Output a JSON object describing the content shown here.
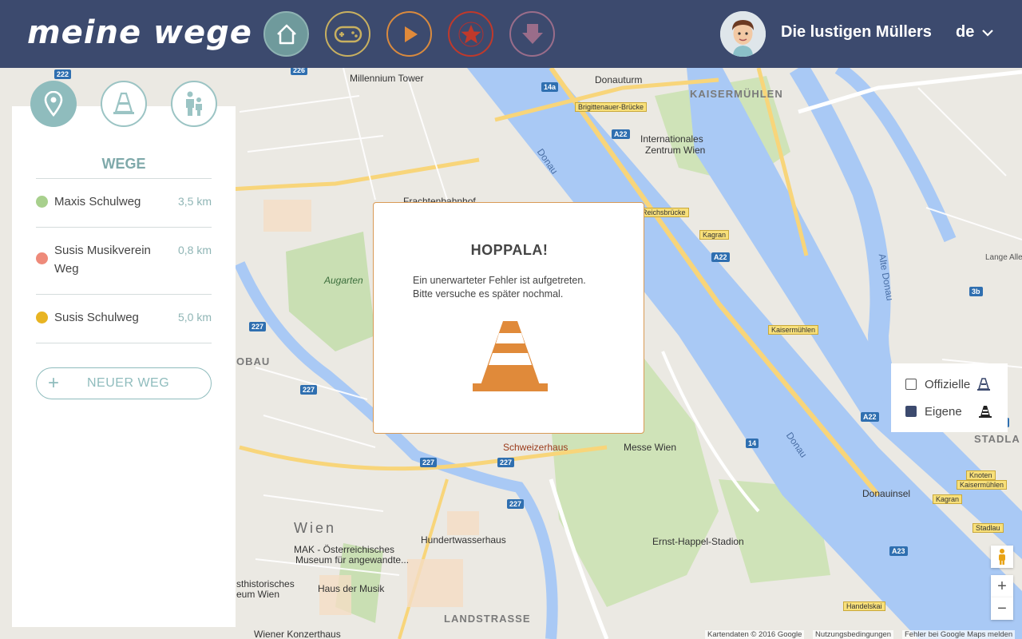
{
  "header": {
    "logo": "meine wege",
    "nav": [
      {
        "name": "home",
        "icon": "home-icon"
      },
      {
        "name": "games",
        "icon": "gamepad-icon"
      },
      {
        "name": "play",
        "icon": "play-icon"
      },
      {
        "name": "favorites",
        "icon": "star-icon"
      },
      {
        "name": "download",
        "icon": "download-icon"
      }
    ],
    "user_name": "Die lustigen Müllers",
    "language": "de"
  },
  "sidebar": {
    "tabs": [
      "route-pin-icon",
      "traffic-cone-icon",
      "family-icon"
    ],
    "title": "WEGE",
    "routes": [
      {
        "name": "Maxis Schulweg",
        "distance": "3,5 km",
        "color": "#a8d08d"
      },
      {
        "name": "Susis Musikverein Weg",
        "distance": "0,8 km",
        "color": "#ee8a7a"
      },
      {
        "name": "Susis Schulweg",
        "distance": "5,0 km",
        "color": "#e8b422"
      }
    ],
    "new_route_label": "NEUER WEG"
  },
  "legend": {
    "items": [
      {
        "label": "Offizielle",
        "checked": false
      },
      {
        "label": "Eigene",
        "checked": true
      }
    ]
  },
  "modal": {
    "title": "HOPPALA!",
    "line1": "Ein unerwarteter Fehler ist aufgetreten.",
    "line2": "Bitte versuche es später nochmal."
  },
  "map": {
    "labels": {
      "millennium": "Millennium Tower",
      "donauturm": "Donauturm",
      "kaisermuehlen": "KAISERMÜHLEN",
      "brigittenauer": "Brigittenauer-Brücke",
      "internationales": "Internationales",
      "zentrum": "Zentrum Wien",
      "augarten": "Augarten",
      "schweizerhaus": "Schweizerhaus",
      "messewien": "Messe Wien",
      "wien": "Wien",
      "mak1": "MAK - Österreichisches",
      "mak2": "Museum für angewandte...",
      "hundertwasser": "Hundertwasserhaus",
      "hausdermusik": "Haus der Musik",
      "landstrasse": "LANDSTRASSE",
      "ernsthappel": "Ernst-Happel-Stadion",
      "donauinsel": "Donauinsel",
      "konzerthaus": "Wiener Konzerthaus",
      "donau1": "Donau",
      "donau2": "Donau",
      "altedonau": "Alte Donau",
      "stadlau": "STADLA",
      "frachtenbahnhof": "Frachtenbahnhof",
      "kagran": "Kagran",
      "kagran2": "Kagran",
      "kaisermuehlen2": "Kaisermühlen",
      "reichsbruecke": "Reichsbrücke",
      "stadlau2": "Stadlau",
      "knoten": "Knoten",
      "knoten2": "Kaisermühlen",
      "handelskai": "Handelskai",
      "historisches": "sthistorisches",
      "historisches2": "eum Wien",
      "obau": "OBAU",
      "lange_allee": "Lange Allee"
    },
    "attribution": {
      "data": "Kartendaten © 2016 Google",
      "terms": "Nutzungsbedingungen",
      "report": "Fehler bei Google Maps melden"
    }
  }
}
